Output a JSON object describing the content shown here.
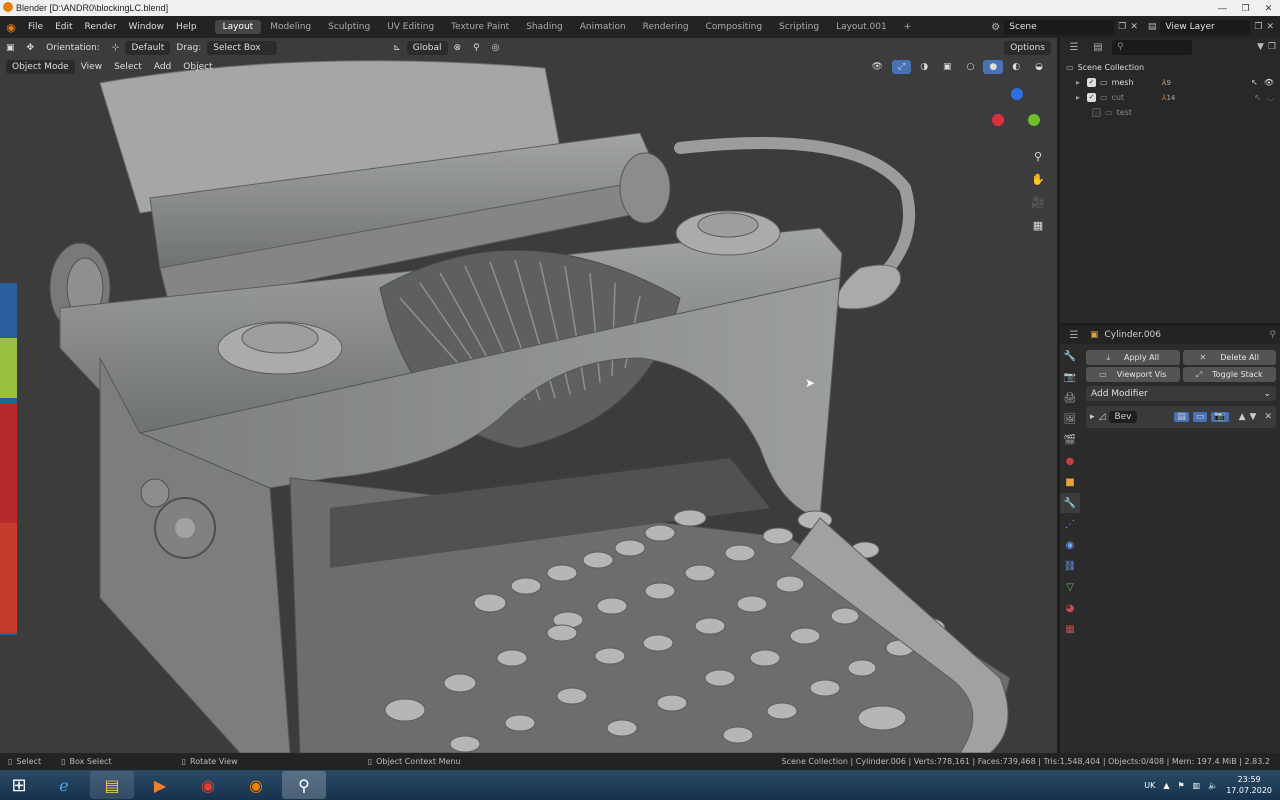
{
  "window": {
    "title": "Blender [D:\\ANDR0\\blockingLC.blend]",
    "min": "—",
    "max": "❐",
    "close": "✕"
  },
  "menu": [
    "File",
    "Edit",
    "Render",
    "Window",
    "Help"
  ],
  "workspaces": [
    "Layout",
    "Modeling",
    "Sculpting",
    "UV Editing",
    "Texture Paint",
    "Shading",
    "Animation",
    "Rendering",
    "Compositing",
    "Scripting",
    "Layout.001"
  ],
  "workspace_add": "+",
  "scene": {
    "label": "Scene",
    "view_layer": "View Layer"
  },
  "tool_header": {
    "orientation_label": "Orientation:",
    "orientation": "Default",
    "drag_label": "Drag:",
    "drag": "Select Box",
    "transform": "Global",
    "options": "Options"
  },
  "viewport_header": {
    "mode": "Object Mode",
    "items": [
      "View",
      "Select",
      "Add",
      "Object"
    ]
  },
  "outliner": {
    "search_placeholder": "",
    "root": "Scene Collection",
    "items": [
      {
        "name": "mesh",
        "badge": "9",
        "visible": true,
        "checked": true
      },
      {
        "name": "cut",
        "badge": "14",
        "visible": false,
        "checked": true
      },
      {
        "name": "test",
        "badge": "",
        "visible": false,
        "checked": false
      }
    ]
  },
  "properties": {
    "object": "Cylinder.006",
    "apply_all": "Apply All",
    "delete_all": "Delete All",
    "viewport_vis": "Viewport Vis",
    "toggle_stack": "Toggle Stack",
    "add_modifier": "Add Modifier",
    "modifier_name": "Bev"
  },
  "status": {
    "select": "Select",
    "box_select": "Box Select",
    "rotate": "Rotate View",
    "context": "Object Context Menu",
    "stats": "Scene Collection | Cylinder.006 | Verts:778,161 | Faces:739,468 | Tris:1,548,404 | Objects:0/408 | Mem: 197.4 MiB | 2.83.2"
  },
  "taskbar": {
    "lang": "UK",
    "time": "23:59",
    "date": "17.07.2020"
  },
  "colors": {
    "accent": "#4772b3",
    "viewport_bg": "#3c3c3c",
    "model": "#8f9290"
  }
}
